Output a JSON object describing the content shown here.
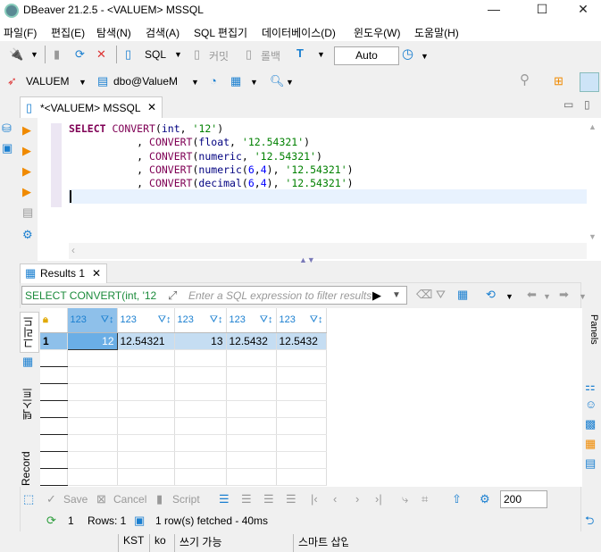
{
  "window": {
    "title": "DBeaver 21.2.5 - <VALUEM> MSSQL",
    "minimize": "—",
    "maximize": "☐",
    "close": "✕"
  },
  "menu": [
    "파일(F)",
    "편집(E)",
    "탐색(N)",
    "검색(A)",
    "SQL 편집기",
    "데이터베이스(D)",
    "윈도우(W)",
    "도움말(H)"
  ],
  "toolbar": {
    "sql_label": "SQL",
    "commit_label": "커밋",
    "rollback_label": "롤백",
    "transaction_mode": "Auto"
  },
  "toolbar2": {
    "datasource": "VALUEM",
    "schema": "dbo@ValueM"
  },
  "editor": {
    "tab_label": "*<VALUEM> MSSQL",
    "lines": [
      [
        [
          "kw",
          "SELECT "
        ],
        [
          "fn",
          "CONVERT"
        ],
        [
          "p",
          "("
        ],
        [
          "ty",
          "int"
        ],
        [
          "p",
          ", "
        ],
        [
          "str",
          "'12'"
        ],
        [
          "p",
          ")"
        ]
      ],
      [
        [
          "p",
          "           , "
        ],
        [
          "fn",
          "CONVERT"
        ],
        [
          "p",
          "("
        ],
        [
          "ty",
          "float"
        ],
        [
          "p",
          ", "
        ],
        [
          "str",
          "'12.54321'"
        ],
        [
          "p",
          ")"
        ]
      ],
      [
        [
          "p",
          "           , "
        ],
        [
          "fn",
          "CONVERT"
        ],
        [
          "p",
          "("
        ],
        [
          "ty",
          "numeric"
        ],
        [
          "p",
          ", "
        ],
        [
          "str",
          "'12.54321'"
        ],
        [
          "p",
          ")"
        ]
      ],
      [
        [
          "p",
          "           , "
        ],
        [
          "fn",
          "CONVERT"
        ],
        [
          "p",
          "("
        ],
        [
          "ty",
          "numeric"
        ],
        [
          "p",
          "("
        ],
        [
          "num",
          "6"
        ],
        [
          "p",
          ","
        ],
        [
          "num",
          "4"
        ],
        [
          "p",
          "), "
        ],
        [
          "str",
          "'12.54321'"
        ],
        [
          "p",
          ")"
        ]
      ],
      [
        [
          "p",
          "           , "
        ],
        [
          "fn",
          "CONVERT"
        ],
        [
          "p",
          "("
        ],
        [
          "ty",
          "decimal"
        ],
        [
          "p",
          "("
        ],
        [
          "num",
          "6"
        ],
        [
          "p",
          ","
        ],
        [
          "num",
          "4"
        ],
        [
          "p",
          "), "
        ],
        [
          "str",
          "'12.54321'"
        ],
        [
          "p",
          ")"
        ]
      ]
    ]
  },
  "results": {
    "tab_label": "Results 1",
    "query_preview": "SELECT CONVERT(int, '12",
    "filter_placeholder": "Enter a SQL expression to filter results",
    "columns": [
      "123",
      "123",
      "123",
      "123",
      "123"
    ],
    "rows": [
      {
        "num": "1",
        "cells": [
          "12",
          "12.54321",
          "13",
          "12.5432",
          "12.5432"
        ]
      }
    ],
    "side_tabs": {
      "grid": "그리드",
      "text": "텍스트",
      "record": "Record"
    },
    "panels_label": "Panels",
    "actions": {
      "save": "Save",
      "cancel": "Cancel",
      "script": "Script"
    },
    "fetch_size": "200",
    "status": {
      "count": "1",
      "rows": "Rows: 1",
      "fetched": "1 row(s) fetched - 40ms"
    }
  },
  "statusbar": {
    "timezone": "KST",
    "locale": "ko",
    "mode": "쓰기 가능",
    "insert": "스마트 삽입"
  }
}
